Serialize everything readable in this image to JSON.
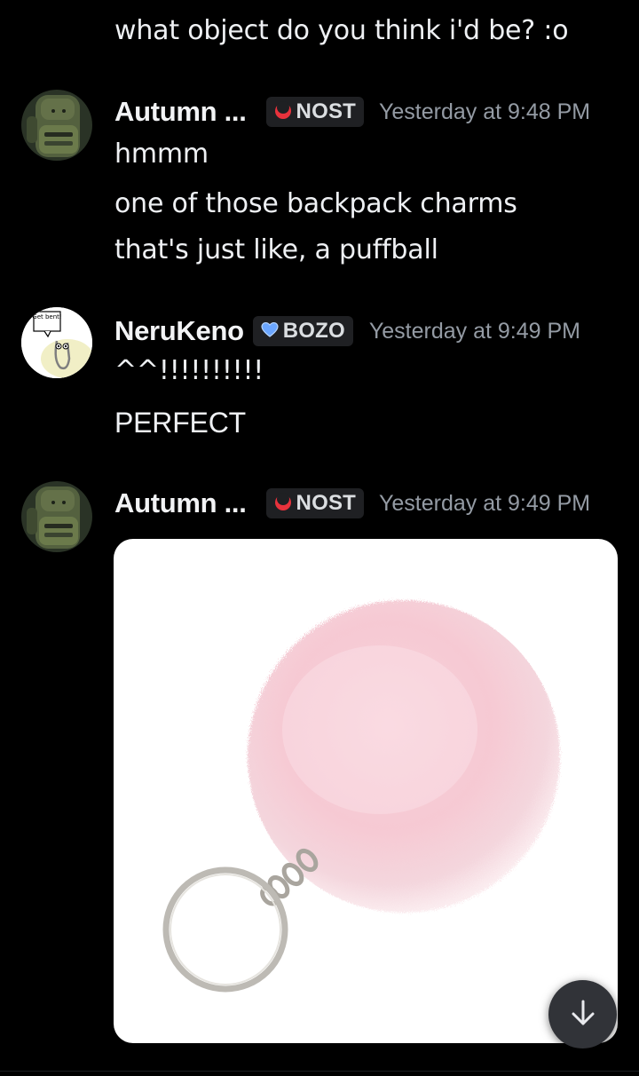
{
  "messages": {
    "top_line": "what object do you think i'd be? :o",
    "group1": {
      "username": "Autumn ...",
      "tag": "NOST",
      "timestamp": "Yesterday at 9:48 PM",
      "lines": [
        "hmmm",
        "one of those backpack charms",
        "that's just like, a puffball"
      ]
    },
    "group2": {
      "username": "NeruKeno",
      "tag": "BOZO",
      "timestamp": "Yesterday at 9:49 PM",
      "lines": [
        "^^!!!!!!!!!!",
        "PERFECT"
      ],
      "avatar_caption": "Get bent!"
    },
    "group3": {
      "username": "Autumn ...",
      "tag": "NOST",
      "timestamp": "Yesterday at 9:49 PM"
    }
  },
  "icons": {
    "nost_tag": "red-crescent-icon",
    "bozo_tag": "blue-heart-icon",
    "scroll": "arrow-down-icon"
  },
  "colors": {
    "background": "#000000",
    "timestamp": "#949ba4",
    "tag_bg": "#1f2023",
    "nost_icon": "#e8323c",
    "bozo_icon": "#6ba6ff",
    "scroll_button": "#313338"
  }
}
